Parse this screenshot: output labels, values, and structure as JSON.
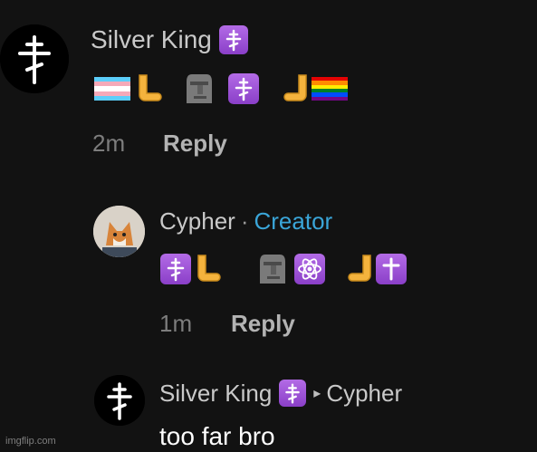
{
  "comments": [
    {
      "username": "Silver King",
      "badge_icon": "orthodox-cross-emoji",
      "emoji_row": [
        "transgender-flag",
        "hand-left",
        "moai",
        "orthodox-cross-emoji",
        "hand-right",
        "rainbow-flag"
      ],
      "time": "2m",
      "reply_label": "Reply"
    },
    {
      "username": "Cypher",
      "separator": "·",
      "role": "Creator",
      "emoji_row": [
        "orthodox-cross-emoji",
        "hand-left",
        "moai",
        "atom-emoji",
        "hand-right",
        "latin-cross-emoji"
      ],
      "time": "1m",
      "reply_label": "Reply"
    },
    {
      "username": "Silver King",
      "badge_icon": "orthodox-cross-emoji",
      "reply_to": "Cypher",
      "text": "too far bro"
    }
  ],
  "colors": {
    "background": "#121212",
    "creator_accent": "#3aa5d8",
    "badge_purple": "#9b51d6"
  },
  "watermark": "imgflip.com"
}
